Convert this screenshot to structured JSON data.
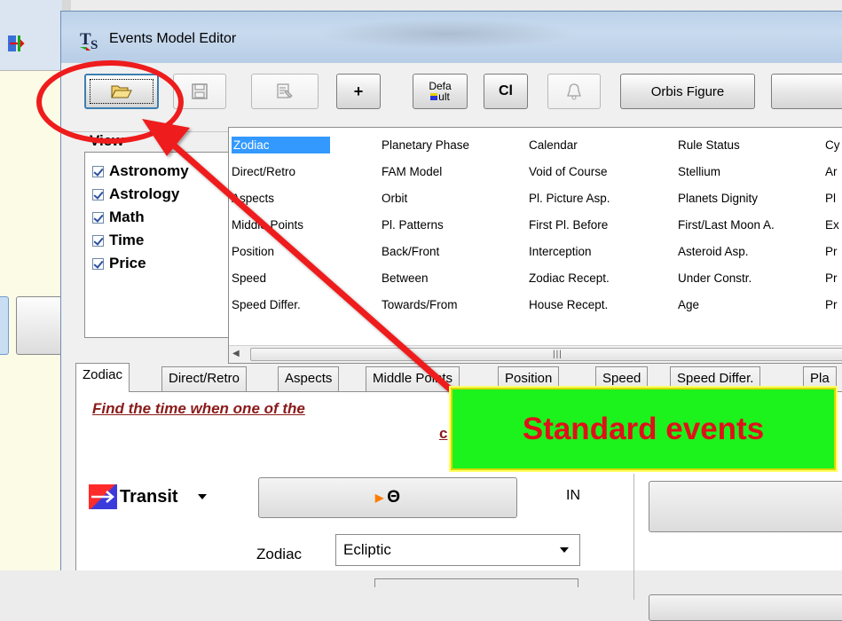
{
  "window": {
    "title": "Events Model Editor",
    "logo_text": "T",
    "logo_sub": "S"
  },
  "toolbar": {
    "open_icon": "folder-open-icon",
    "save_icon": "floppy-disk-icon",
    "properties_icon": "properties-icon",
    "add_label": "+",
    "default_label_top": "Defa",
    "default_label_bottom": "ult",
    "cl_label": "Cl",
    "bell_icon": "bell-icon",
    "orbis_label": "Orbis Figure"
  },
  "view": {
    "title": "View",
    "items": [
      {
        "label": "Astronomy",
        "checked": true
      },
      {
        "label": "Astrology",
        "checked": true
      },
      {
        "label": "Math",
        "checked": true
      },
      {
        "label": "Time",
        "checked": true
      },
      {
        "label": "Price",
        "checked": true
      }
    ]
  },
  "events": {
    "columns": [
      [
        "Zodiac",
        "Direct/Retro",
        "Aspects",
        "Middle Points",
        "Position",
        "Speed",
        "Speed Differ."
      ],
      [
        "Planetary Phase",
        "FAM Model",
        "Orbit",
        "Pl. Patterns",
        "Back/Front",
        "Between",
        "Towards/From"
      ],
      [
        "Calendar",
        "Void of Course",
        "Pl. Picture Asp.",
        "First Pl. Before",
        "Interception",
        "Zodiac Recept.",
        "House Recept."
      ],
      [
        "Rule Status",
        "Stellium",
        "Planets Dignity",
        "First/Last Moon A.",
        "Asteroid Asp.",
        "Under Constr.",
        "Age"
      ],
      [
        "Cy",
        "Ar",
        "Pl",
        "Ex",
        "Pr",
        "Pr",
        "Pr"
      ]
    ],
    "selected": "Zodiac"
  },
  "tabs": [
    "Zodiac",
    "Direct/Retro",
    "Aspects",
    "Middle Points",
    "Position",
    "Speed",
    "Speed Differ.",
    "Pla"
  ],
  "content": {
    "find_text": "Find the time when one of the",
    "find_text_cont": "c",
    "transit_label": "Transit",
    "sun_symbol": "Θ",
    "in_label": "IN",
    "zodiac_label": "Zodiac",
    "zodiac_value": "Ecliptic"
  },
  "callout": {
    "text": "Standard events"
  },
  "colors": {
    "callout_bg": "#1cf21c",
    "callout_text": "#e0101a",
    "annotation_red": "#ee1c1c",
    "selection": "#3399ff"
  }
}
